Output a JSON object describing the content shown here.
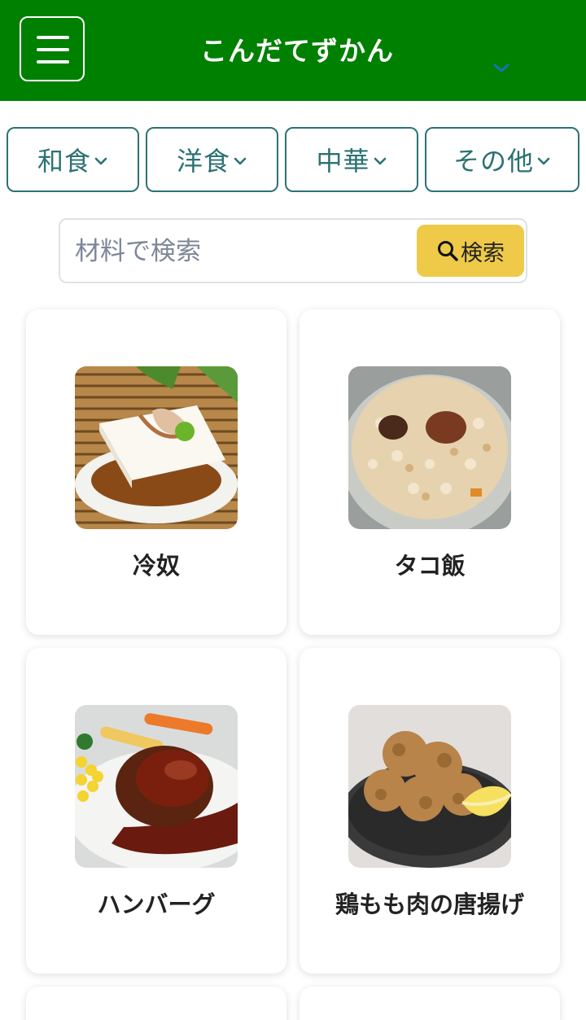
{
  "header": {
    "title": "こんだてずかん",
    "menu_icon": "hamburger-menu-icon",
    "dropdown_icon": "chevron-down-icon"
  },
  "categories": [
    {
      "label": "和食"
    },
    {
      "label": "洋食"
    },
    {
      "label": "中華"
    },
    {
      "label": "その他"
    }
  ],
  "search": {
    "placeholder": "材料で検索",
    "value": "",
    "button_label": "検索",
    "icon": "search-icon"
  },
  "recipes": [
    {
      "name": "冷奴"
    },
    {
      "name": "タコ飯"
    },
    {
      "name": "ハンバーグ"
    },
    {
      "name": "鶏もも肉の唐揚げ"
    }
  ],
  "colors": {
    "header_bg": "#008000",
    "category_border": "#2c7272",
    "search_button": "#eeca48"
  }
}
